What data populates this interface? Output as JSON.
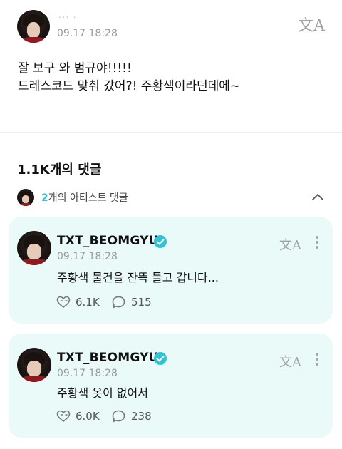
{
  "post": {
    "author_name": "··· ·",
    "time": "09.17 18:28",
    "body_lines": [
      "잘 보구 와 범규야!!!!!",
      "드레스코드 맞춰 갔어?! 주황색이라던데에~"
    ],
    "translate_icon": "文A"
  },
  "comments_header": {
    "count_label": "1.1K개의 댓글"
  },
  "artist_bar": {
    "count": "2",
    "label": "개의 아티스트 댓글"
  },
  "comments": [
    {
      "author": "TXT_BEOMGYU",
      "time": "09.17 18:28",
      "text": "주황색 물건을 잔뜩 들고 갑니다...",
      "likes": "6.1K",
      "replies": "515",
      "translate_icon": "文A"
    },
    {
      "author": "TXT_BEOMGYU",
      "time": "09.17 18:28",
      "text": "주황색 옷이 없어서",
      "likes": "6.0K",
      "replies": "238",
      "translate_icon": "文A"
    }
  ],
  "icons": {
    "translate": "translate-icon",
    "chevron": "chevron-up-icon",
    "more": "more-options-icon",
    "verified": "verified-badge-icon",
    "like": "heart-like-icon",
    "reply": "reply-bubble-icon"
  },
  "colors": {
    "accent": "#2bc7d4",
    "card_background": "#e9faf8",
    "verified_badge": "#30c3d6",
    "muted_text": "#9a9a9a"
  }
}
